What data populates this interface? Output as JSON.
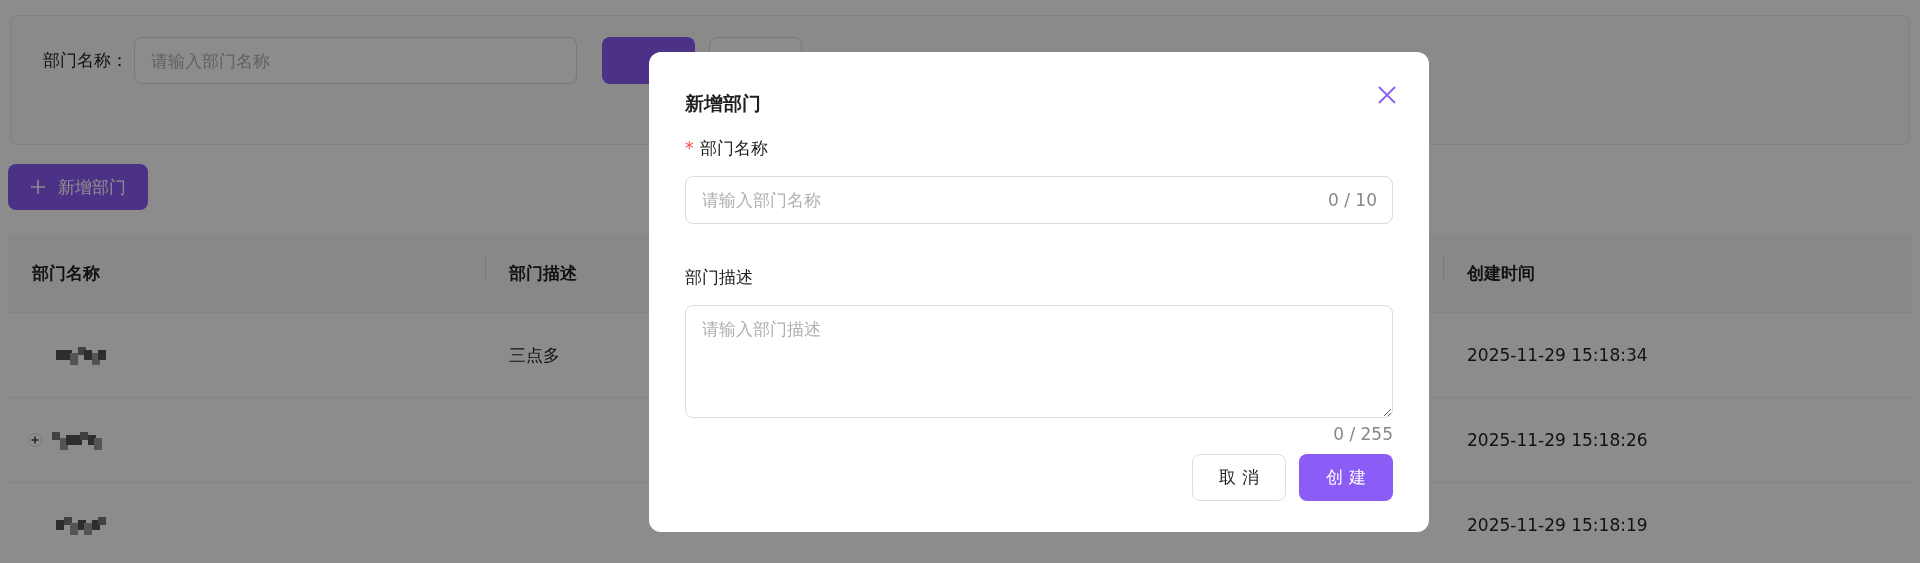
{
  "search_bar": {
    "label": "部门名称：",
    "placeholder": "请输入部门名称"
  },
  "add_button": {
    "label": "新增部门"
  },
  "table": {
    "columns": [
      "部门名称",
      "部门描述",
      "创建时间"
    ],
    "rows": [
      {
        "expandable": false,
        "description": "三点多",
        "created": "2025-11-29 15:18:34"
      },
      {
        "expandable": true,
        "description": "",
        "created": "2025-11-29 15:18:26"
      },
      {
        "expandable": false,
        "description": "",
        "created": "2025-11-29 15:18:19"
      }
    ]
  },
  "dialog": {
    "title": "新增部门",
    "fields": [
      {
        "kind": "input",
        "required_mark": "*",
        "label": "部门名称",
        "placeholder": "请输入部门名称",
        "counter": "0 / 10"
      },
      {
        "kind": "textarea",
        "label": "部门描述",
        "placeholder": "请输入部门描述",
        "counter": "0 / 255"
      }
    ],
    "buttons": [
      {
        "kind": "default",
        "label": "取 消"
      },
      {
        "kind": "primary",
        "label": "创 建"
      }
    ]
  }
}
